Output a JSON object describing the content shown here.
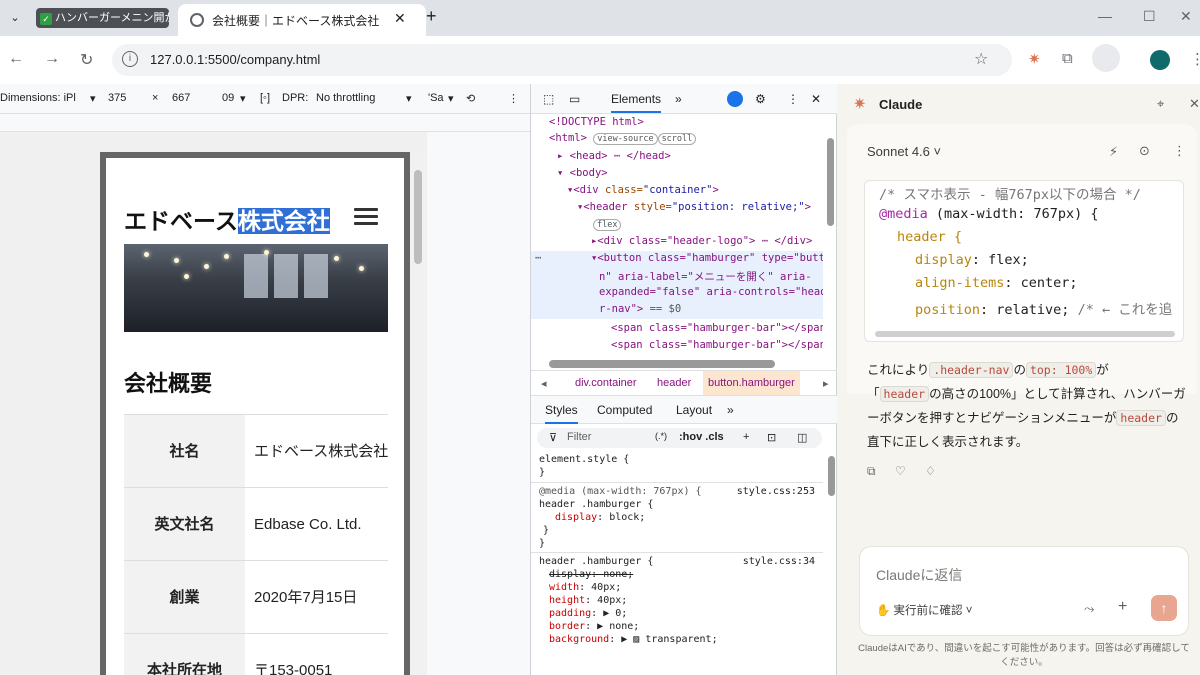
{
  "browser": {
    "tab_group_label": "ハンバーガーメニン開か",
    "active_tab_title": "会社概要｜エドベース株式会社",
    "url": "127.0.0.1:5500/company.html"
  },
  "device_toolbar": {
    "dimensions_label": "Dimensions: iPl",
    "width": "375",
    "times": "×",
    "height": "667",
    "zoom": "09",
    "dpr_label": "DPR:",
    "throttle": "No throttling",
    "save_data": "'Sa"
  },
  "page": {
    "logo_plain": "エドベース",
    "logo_selected": "株式会社",
    "heading": "会社概要",
    "rows": [
      {
        "label": "社名",
        "value": "エドベース株式会社"
      },
      {
        "label": "英文社名",
        "value": "Edbase Co. Ltd."
      },
      {
        "label": "創業",
        "value": "2020年7月15日"
      },
      {
        "label": "本社所在地",
        "value": "〒153-0051"
      }
    ]
  },
  "devtools": {
    "tab_elements": "Elements",
    "more": "»",
    "doctype": "<!DOCTYPE html>",
    "html_open": "<html>",
    "view_source": "view-source",
    "scroll_pill": "scroll",
    "head_line": "<head> ⋯ </head>",
    "body_open": "<body>",
    "div_container_tag": "<div",
    "class_attr": "class=",
    "container_val": "\"container\"",
    "header_tag": "<header",
    "style_attr": "style=",
    "header_style_val": "\"position: relative;\"",
    "flex_pill": "flex",
    "header_logo_line": "<div class=\"header-logo\"> ⋯ </div>",
    "button_line1": "<button class=\"hamburger\" type=\"butto",
    "button_line2": "n\" aria-label=\"メニューを開く\" aria-",
    "button_line3": "expanded=\"false\" aria-controls=\"heade",
    "button_line4": "r-nav\">",
    "eq_s0": "== $0",
    "span_line": "<span class=\"hamburger-bar\"></span>",
    "breadcrumbs": [
      "div.container",
      "header",
      "button.hamburger"
    ],
    "style_tabs": [
      "Styles",
      "Computed",
      "Layout",
      "»"
    ],
    "filter_placeholder": "Filter",
    "filter_tools": ":hov  .cls",
    "styles_rules": {
      "element_style": "element.style {",
      "close": "}",
      "media_line": "@media (max-width: 767px) {",
      "media_src": "style.css:253",
      "media_selector": "header .hamburger {",
      "media_prop": "display",
      "media_val": "block;",
      "rule_selector": "header .hamburger {",
      "rule_src": "style.css:34",
      "props": [
        {
          "p": "display",
          "v": "none;"
        },
        {
          "p": "width",
          "v": "40px;"
        },
        {
          "p": "height",
          "v": "40px;"
        },
        {
          "p": "padding",
          "v": "▶ 0;"
        },
        {
          "p": "border",
          "v": "▶ none;"
        },
        {
          "p": "background",
          "v": "▶ ▨ transparent;"
        }
      ]
    }
  },
  "claude": {
    "title": "Claude",
    "model": "Sonnet 4.6 ˅",
    "code": {
      "comment1": "/* スマホ表示 - 幅767px以下の場合 */",
      "media_kw": "@media",
      "media_cond": " (max-width: 767px) {",
      "selector": "header {",
      "p1": "display",
      "v1": ": flex;",
      "p2": "align-items",
      "v2": ": center;",
      "p3": "position",
      "v3": ": relative;",
      "comment2": "/* ← これを追"
    },
    "message": {
      "t1": "これにより",
      "c1": ".header-nav",
      "t2": "の",
      "c2": "top: 100%",
      "t3": "が",
      "t4": "「",
      "c3": "header",
      "t5": "の高さの100%」として計算され、ハンバーガーボタンを押すとナビゲーションメニューが",
      "c4": "header",
      "t6": "の直下に正しく表示されます。"
    },
    "feedback_icons": "⧉ ♡ ♢",
    "input_placeholder": "Claudeに返信",
    "mode_label": "実行前に確認 ˅",
    "disclaimer": "ClaudeはAIであり、間違いを起こす可能性があります。回答は必ず再確認してください。"
  }
}
